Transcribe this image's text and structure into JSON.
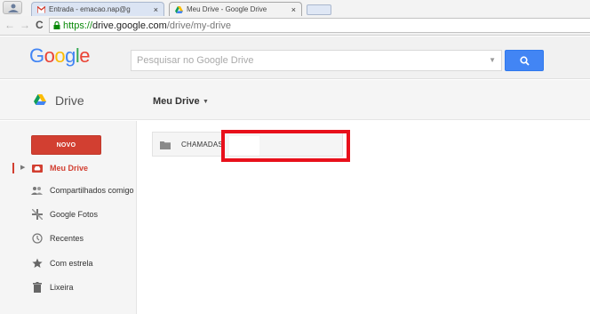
{
  "browser": {
    "tabs": [
      {
        "title": "Entrada - emacao.nap@g",
        "favicon": "gmail-icon",
        "active": false
      },
      {
        "title": "Meu Drive - Google Drive",
        "favicon": "drive-icon",
        "active": true
      }
    ],
    "close_glyph": "×",
    "url": {
      "scheme": "https://",
      "host": "drive.google.com",
      "path": "/drive/my-drive"
    }
  },
  "header": {
    "logo": "Google",
    "search_placeholder": "Pesquisar no Google Drive"
  },
  "subheader": {
    "app_name": "Drive",
    "breadcrumb": "Meu Drive"
  },
  "sidebar": {
    "new_button": "NOVO",
    "items": [
      {
        "label": "Meu Drive",
        "icon": "drive-folder-icon",
        "active": true
      },
      {
        "label": "Compartilhados comigo",
        "icon": "people-icon",
        "active": false
      },
      {
        "label": "Google Fotos",
        "icon": "photos-icon",
        "active": false
      },
      {
        "label": "Recentes",
        "icon": "clock-icon",
        "active": false
      },
      {
        "label": "Com estrela",
        "icon": "star-icon",
        "active": false
      },
      {
        "label": "Lixeira",
        "icon": "trash-icon",
        "active": false
      }
    ]
  },
  "main": {
    "folders": [
      {
        "name": "CHAMADAS"
      }
    ]
  },
  "colors": {
    "accent_red": "#d23f31",
    "search_blue": "#4285f4",
    "redaction_red": "#e8101b"
  }
}
